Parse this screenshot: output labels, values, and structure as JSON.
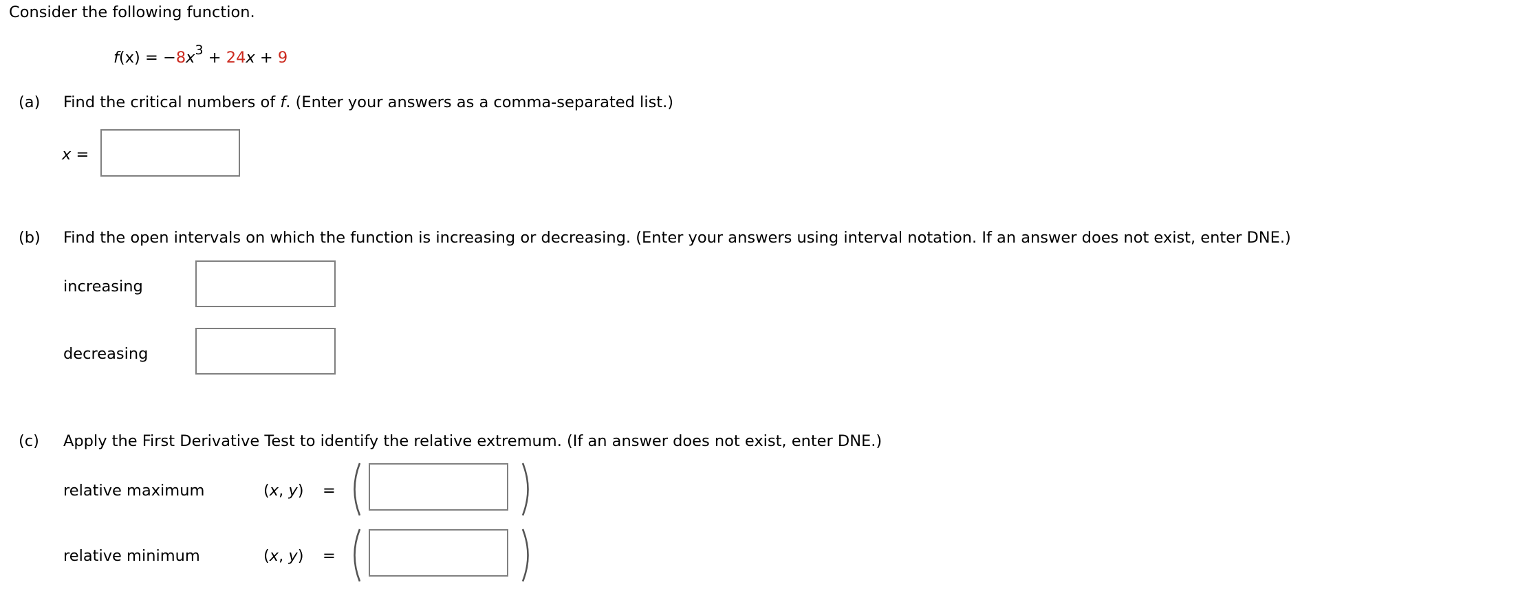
{
  "intro": "Consider the following function.",
  "function": {
    "lhs_func": "f",
    "lhs_var": "(x)",
    "equals": "=",
    "minus": "−",
    "coef1": "8",
    "var1": "x",
    "exp1": "3",
    "plus1": "+",
    "coef2": "24",
    "var2": "x",
    "plus2": "+",
    "const": "9",
    "accent_color": "#cc2a1f"
  },
  "part_a": {
    "label": "(a)",
    "prompt_pre": "Find the critical numbers of ",
    "prompt_var": "f",
    "prompt_post": ". (Enter your answers as a comma-separated list.)",
    "answer_var": "x",
    "answer_eq": "=",
    "answer_value": ""
  },
  "part_b": {
    "label": "(b)",
    "prompt": "Find the open intervals on which the function is increasing or decreasing. (Enter your answers using interval notation. If an answer does not exist, enter DNE.)",
    "increasing_label": "increasing",
    "increasing_value": "",
    "decreasing_label": "decreasing",
    "decreasing_value": ""
  },
  "part_c": {
    "label": "(c)",
    "prompt": "Apply the First Derivative Test to identify the relative extremum. (If an answer does not exist, enter DNE.)",
    "max_label": "relative maximum",
    "min_label": "relative minimum",
    "pair_open": "(",
    "pair_x": "x",
    "pair_comma": ", ",
    "pair_y": "y",
    "pair_close": ")",
    "pair_eq": "=",
    "max_value": "",
    "min_value": ""
  },
  "input_border_color": "#808080"
}
